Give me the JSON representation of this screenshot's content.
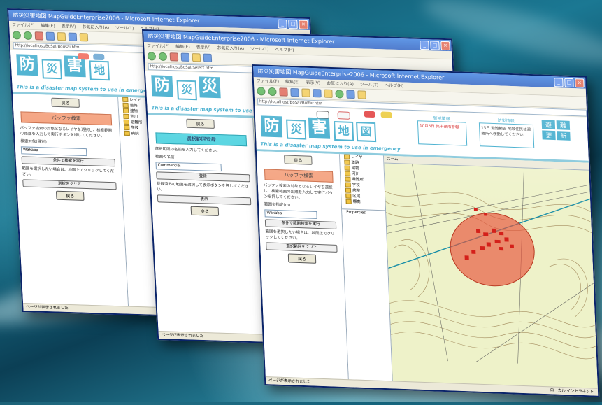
{
  "windows": {
    "back": {
      "title": "防災災害地図 MapGuideEnterprise2006 - Microsoft Internet Explorer",
      "menu": [
        "ファイル(F)",
        "編集(E)",
        "表示(V)",
        "お気に入り(A)",
        "ツール(T)",
        "ヘルプ(H)"
      ],
      "address": "http://localhost/BoSai/Bousai.htm",
      "logo_kanji": [
        "防",
        "災",
        "害",
        "地"
      ],
      "tagline": "This is a disaster map system to use in emergency",
      "button_top": "戻る",
      "section_title": "バッファ検索",
      "paragraph": "バッファ検索の対象となるレイヤを選択し、検索範囲の距離を入力して実行ボタンを押してください。",
      "select_label": "検索対象(種別)",
      "select_value": "Wakaba",
      "action_button": "条件で検索を実行",
      "note": "範囲を選択したい場合は、地図上でクリックしてください。",
      "clear_button": "選択をクリア",
      "button_bottom": "戻る",
      "tree_items": [
        "レイヤ",
        "道路",
        "建物",
        "河川",
        "避難所",
        "学校",
        "病院"
      ],
      "status": "ページが表示されました"
    },
    "middle": {
      "title": "防災災害地図 MapGuideEnterprise2006 - Microsoft Internet Explorer",
      "menu": [
        "ファイル(F)",
        "編集(E)",
        "表示(V)",
        "お気に入り(A)",
        "ツール(T)",
        "ヘルプ(H)"
      ],
      "address": "http://localhost/BoSai/Select.htm",
      "logo_kanji": [
        "防",
        "災",
        "災"
      ],
      "tagline": "This is a disaster map system to use in emergency",
      "button_top": "戻る",
      "section_title": "選択範囲登録",
      "paragraph": "選択範囲の名前を入力してください。",
      "select_label": "範囲の名前",
      "select_value": "Commercial",
      "action_button": "登録",
      "note": "登録済みの範囲を選択して表示ボタンを押してください。",
      "clear_button": "表示",
      "button_bottom": "戻る",
      "status": "ページが表示されました"
    },
    "front": {
      "title": "防災災害地図 MapGuideEnterprise2006 - Microsoft Internet Explorer",
      "menu": [
        "ファイル(F)",
        "編集(E)",
        "表示(V)",
        "お気に入り(A)",
        "ツール(T)",
        "ヘルプ(H)"
      ],
      "address": "http://localhost/BoSai/Buffer.htm",
      "logo_kanji": [
        "防",
        "災",
        "害",
        "地",
        "図"
      ],
      "tagline": "This is a disaster map system to use in emergency",
      "header_box_left_title": "警戒情報",
      "header_box_left_text": "10月6日 集中豪雨警報",
      "header_box_right_title": "防災情報",
      "header_box_right_text": "15日 避難勧告 地域住民は避難所へ移動してください",
      "side_buttons": [
        "避",
        "難",
        "更",
        "新"
      ],
      "button_top": "戻る",
      "section_title": "バッファ検索",
      "paragraph": "バッファ検索の対象となるレイヤを選択し、検索範囲の距離を入力して実行ボタンを押してください。",
      "select_label": "範囲を指定(m)",
      "select_value": "Wakaba",
      "action_button": "条件で範囲検索を実行",
      "note": "範囲を選択したい場合は、地図上でクリックしてください。",
      "clear_button": "選択範囲をクリア",
      "button_bottom": "戻る",
      "tree_items": [
        "レイヤ",
        "道路",
        "建物",
        "河川",
        "避難所",
        "学校",
        "病院",
        "区域",
        "標高"
      ],
      "tree_footer": "Properties",
      "map_toolbar": "ズーム",
      "status": "ページが表示されました",
      "status_right": "ローカル イントラネット"
    }
  },
  "colors": {
    "accent": "#2ba3c8",
    "buffer_fill": "#e8523a",
    "buildings": "#d4201a",
    "map_bg": "#eef2c9",
    "contour": "#8b6a3a"
  }
}
